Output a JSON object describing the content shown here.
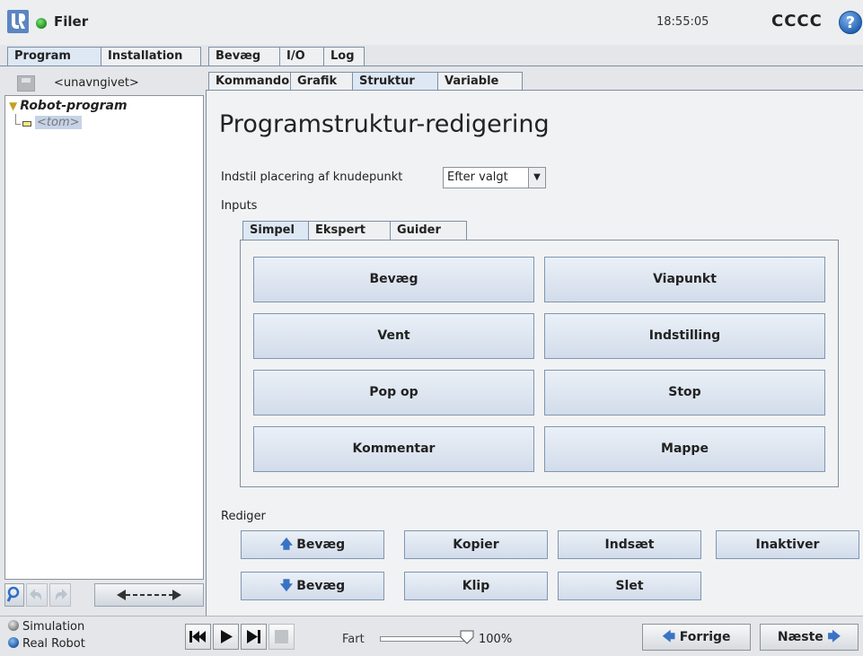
{
  "header": {
    "files_label": "Filer",
    "time": "18:55:05",
    "robot_name": "CCCC",
    "help": "?"
  },
  "main_tabs": [
    "Program",
    "Installation",
    "Bevæg",
    "I/O",
    "Log"
  ],
  "program": {
    "file_name": "<unavngivet>",
    "tree_root": "Robot-program",
    "tree_child": "<tom>"
  },
  "sub_tabs": [
    "Kommando",
    "Grafik",
    "Struktur",
    "Variable"
  ],
  "editor": {
    "title": "Programstruktur-redigering",
    "placement_label": "Indstil placering af knudepunkt",
    "placement_value": "Efter valgt",
    "inputs_label": "Inputs",
    "input_tabs": [
      "Simpel",
      "Ekspert",
      "Guider"
    ],
    "commands": [
      "Bevæg",
      "Viapunkt",
      "Vent",
      "Indstilling",
      "Pop op",
      "Stop",
      "Kommentar",
      "Mappe"
    ],
    "rediger_label": "Rediger",
    "edit_buttons": {
      "move_up": "Bevæg",
      "copy": "Kopier",
      "paste": "Indsæt",
      "deactivate": "Inaktiver",
      "move_down": "Bevæg",
      "cut": "Klip",
      "delete": "Slet"
    }
  },
  "footer": {
    "simulation": "Simulation",
    "real_robot": "Real Robot",
    "speed_label": "Fart",
    "speed_value": "100%",
    "speed_fraction": 1.0,
    "prev": "Forrige",
    "next": "Næste"
  },
  "colors": {
    "accent_blue": "#3a73c4",
    "status_green": "#1f8f1d"
  }
}
